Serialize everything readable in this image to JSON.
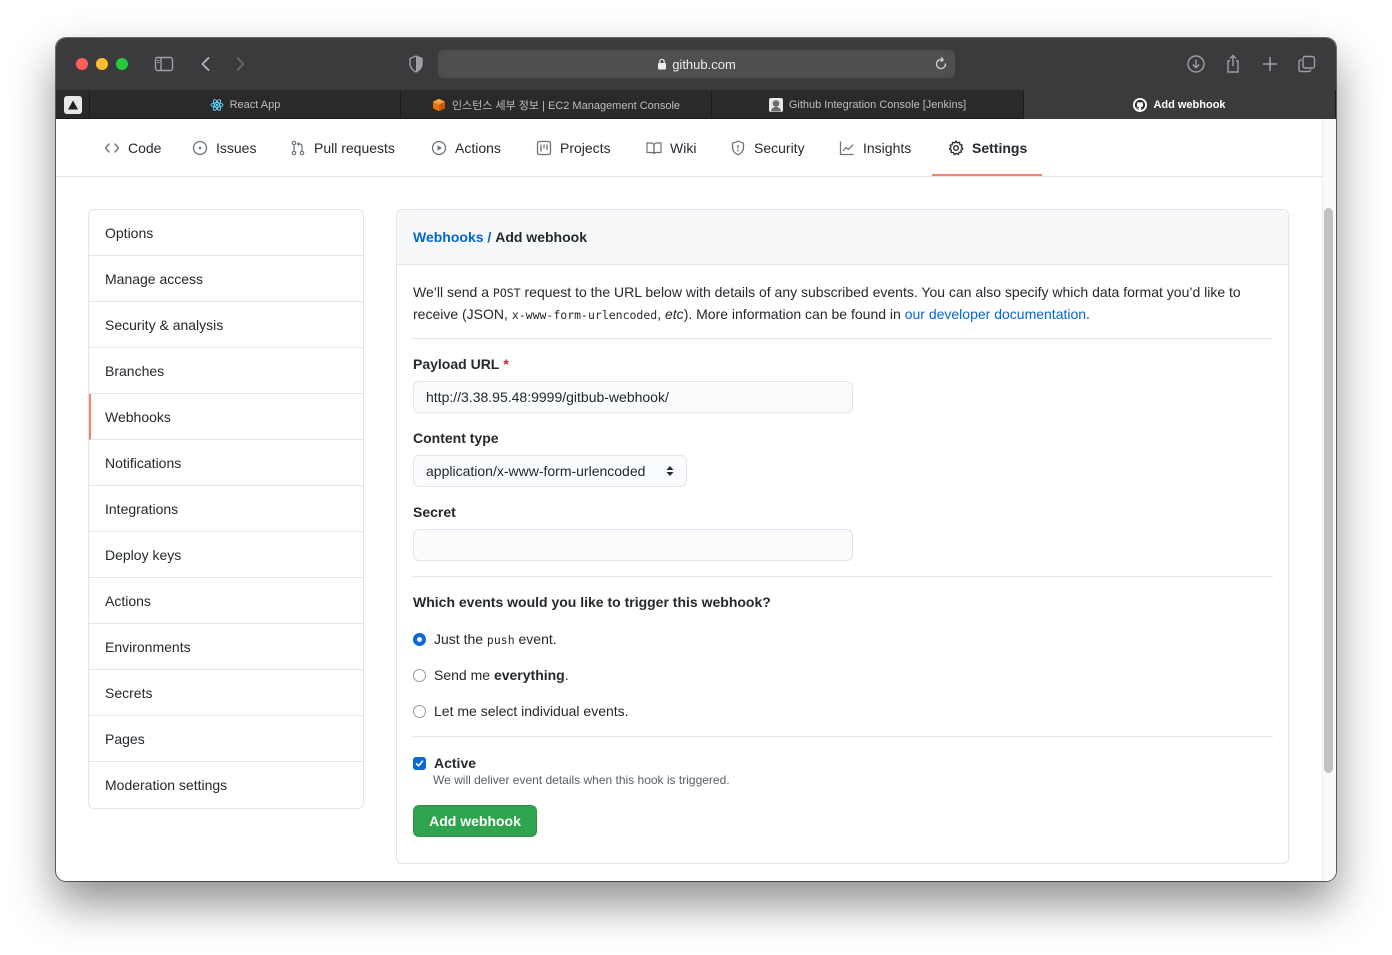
{
  "browser": {
    "url": "github.com",
    "tabs": [
      {
        "title": "React App",
        "active": false
      },
      {
        "title": "인스턴스 세부 정보 | EC2 Management Console",
        "active": false
      },
      {
        "title": "Github Integration Console [Jenkins]",
        "active": false
      },
      {
        "title": "Add webhook",
        "active": true
      }
    ]
  },
  "repo_nav": {
    "items": [
      {
        "label": "Code",
        "icon": "code-icon"
      },
      {
        "label": "Issues",
        "icon": "issue-icon"
      },
      {
        "label": "Pull requests",
        "icon": "pull-request-icon"
      },
      {
        "label": "Actions",
        "icon": "play-icon"
      },
      {
        "label": "Projects",
        "icon": "project-icon"
      },
      {
        "label": "Wiki",
        "icon": "book-icon"
      },
      {
        "label": "Security",
        "icon": "shield-icon"
      },
      {
        "label": "Insights",
        "icon": "graph-icon"
      },
      {
        "label": "Settings",
        "icon": "gear-icon",
        "selected": true
      }
    ]
  },
  "sidebar": {
    "items": [
      {
        "label": "Options"
      },
      {
        "label": "Manage access"
      },
      {
        "label": "Security & analysis"
      },
      {
        "label": "Branches"
      },
      {
        "label": "Webhooks",
        "active": true
      },
      {
        "label": "Notifications"
      },
      {
        "label": "Integrations"
      },
      {
        "label": "Deploy keys"
      },
      {
        "label": "Actions"
      },
      {
        "label": "Environments"
      },
      {
        "label": "Secrets"
      },
      {
        "label": "Pages"
      },
      {
        "label": "Moderation settings"
      }
    ]
  },
  "main": {
    "breadcrumb_link": "Webhooks",
    "breadcrumb_sep": " / ",
    "breadcrumb_current": "Add webhook",
    "intro": {
      "p1": "We’ll send a ",
      "code1": "POST",
      "p2": " request to the URL below with details of any subscribed events. You can also specify which data format you’d like to receive (JSON, ",
      "code2": "x-www-form-urlencoded",
      "p3": ", ",
      "em": "etc",
      "p4": "). More information can be found in ",
      "link": "our developer documentation",
      "p5": "."
    },
    "payload_url_label": "Payload URL",
    "required_mark": "*",
    "payload_url_value": "http://3.38.95.48:9999/gitbub-webhook/",
    "content_type_label": "Content type",
    "content_type_value": "application/x-www-form-urlencoded",
    "secret_label": "Secret",
    "secret_value": "",
    "events_question": "Which events would you like to trigger this webhook?",
    "event_options": {
      "push_prefix": "Just the ",
      "push_code": "push",
      "push_suffix": " event.",
      "everything_prefix": "Send me ",
      "everything_bold": "everything",
      "everything_suffix": ".",
      "individual": "Let me select individual events."
    },
    "selected_event": "push",
    "active_label": "Active",
    "active_checked": true,
    "active_help": "We will deliver event details when this hook is triggered.",
    "submit_label": "Add webhook"
  },
  "colors": {
    "accent_link": "#0366d6",
    "primary_button": "#2ea44f",
    "nav_underline": "#f9826c",
    "required": "#cb2431"
  }
}
